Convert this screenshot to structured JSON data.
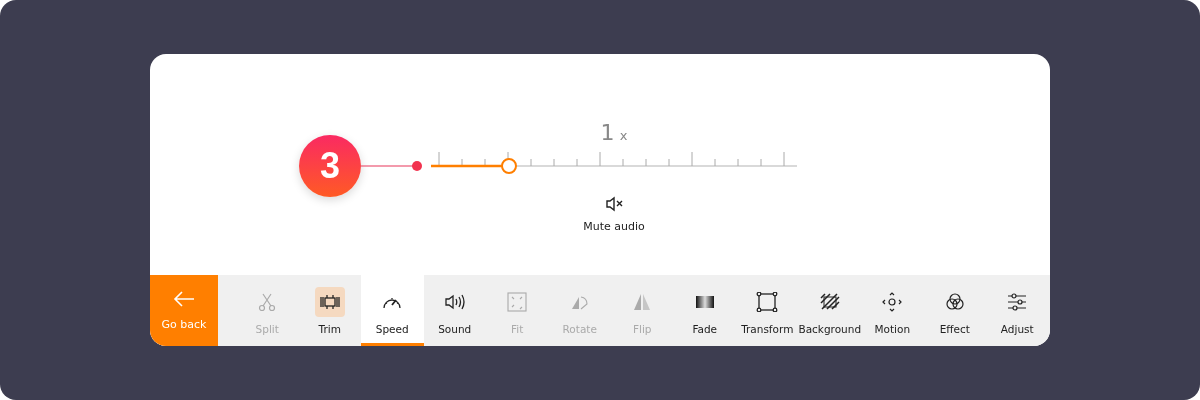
{
  "speed": {
    "value": "1",
    "unit": "x",
    "level": 0.214
  },
  "step_badge": {
    "number": "3"
  },
  "mute": {
    "label": "Mute audio"
  },
  "back_button": {
    "label": "Go back"
  },
  "tools": [
    {
      "kind": "split",
      "label": "Split",
      "disabled": true,
      "highlighted": false,
      "selected": false
    },
    {
      "kind": "trim",
      "label": "Trim",
      "disabled": false,
      "highlighted": true,
      "selected": false
    },
    {
      "kind": "speed",
      "label": "Speed",
      "disabled": false,
      "highlighted": false,
      "selected": true
    },
    {
      "kind": "sound",
      "label": "Sound",
      "disabled": false,
      "highlighted": false,
      "selected": false
    },
    {
      "kind": "fit",
      "label": "Fit",
      "disabled": true,
      "highlighted": false,
      "selected": false
    },
    {
      "kind": "rotate",
      "label": "Rotate",
      "disabled": true,
      "highlighted": false,
      "selected": false
    },
    {
      "kind": "flip",
      "label": "Flip",
      "disabled": true,
      "highlighted": false,
      "selected": false
    },
    {
      "kind": "fade",
      "label": "Fade",
      "disabled": false,
      "highlighted": false,
      "selected": false
    },
    {
      "kind": "transform",
      "label": "Transform",
      "disabled": false,
      "highlighted": false,
      "selected": false
    },
    {
      "kind": "background",
      "label": "Background",
      "disabled": false,
      "highlighted": false,
      "selected": false
    },
    {
      "kind": "motion",
      "label": "Motion",
      "disabled": false,
      "highlighted": false,
      "selected": false
    },
    {
      "kind": "effect",
      "label": "Effect",
      "disabled": false,
      "highlighted": false,
      "selected": false
    },
    {
      "kind": "adjust",
      "label": "Adjust",
      "disabled": false,
      "highlighted": false,
      "selected": false
    }
  ]
}
